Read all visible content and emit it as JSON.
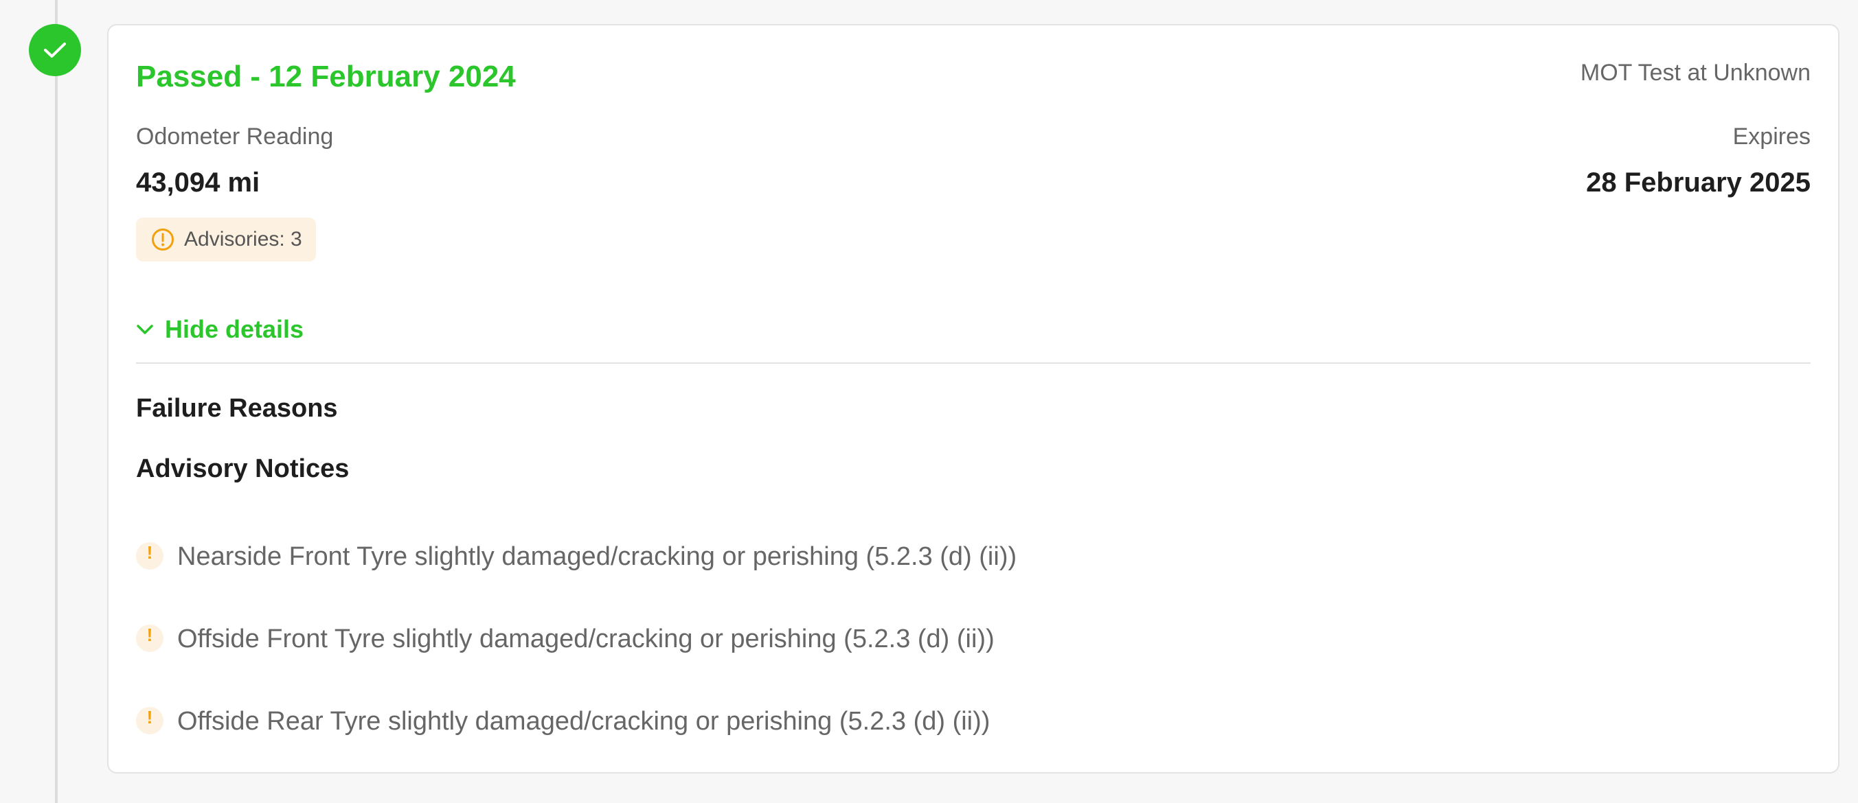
{
  "result": {
    "status_title": "Passed - 12 February 2024",
    "test_location": "MOT Test at Unknown"
  },
  "odometer": {
    "label": "Odometer Reading",
    "value": "43,094 mi"
  },
  "expiry": {
    "label": "Expires",
    "value": "28 February 2025"
  },
  "advisory_badge": {
    "label": "Advisories: 3"
  },
  "details_toggle": {
    "label": "Hide details"
  },
  "sections": {
    "failure_reasons_heading": "Failure Reasons",
    "advisory_notices_heading": "Advisory Notices"
  },
  "advisories": [
    {
      "text": "Nearside Front Tyre slightly damaged/cracking or perishing (5.2.3 (d) (ii))",
      "icon": "!"
    },
    {
      "text": "Offside Front Tyre slightly damaged/cracking or perishing (5.2.3 (d) (ii))",
      "icon": "!"
    },
    {
      "text": "Offside Rear Tyre slightly damaged/cracking or perishing (5.2.3 (d) (ii))",
      "icon": "!"
    }
  ],
  "icons": {
    "status": "check-icon",
    "badge": "warning-circle-icon",
    "toggle": "chevron-down-icon",
    "advisory": "warning-dot-icon"
  },
  "colors": {
    "pass_green": "#2bc62b",
    "warning_orange": "#f2a00c",
    "warning_bg": "#fdf1e1",
    "card_border": "#e3e3e3"
  }
}
